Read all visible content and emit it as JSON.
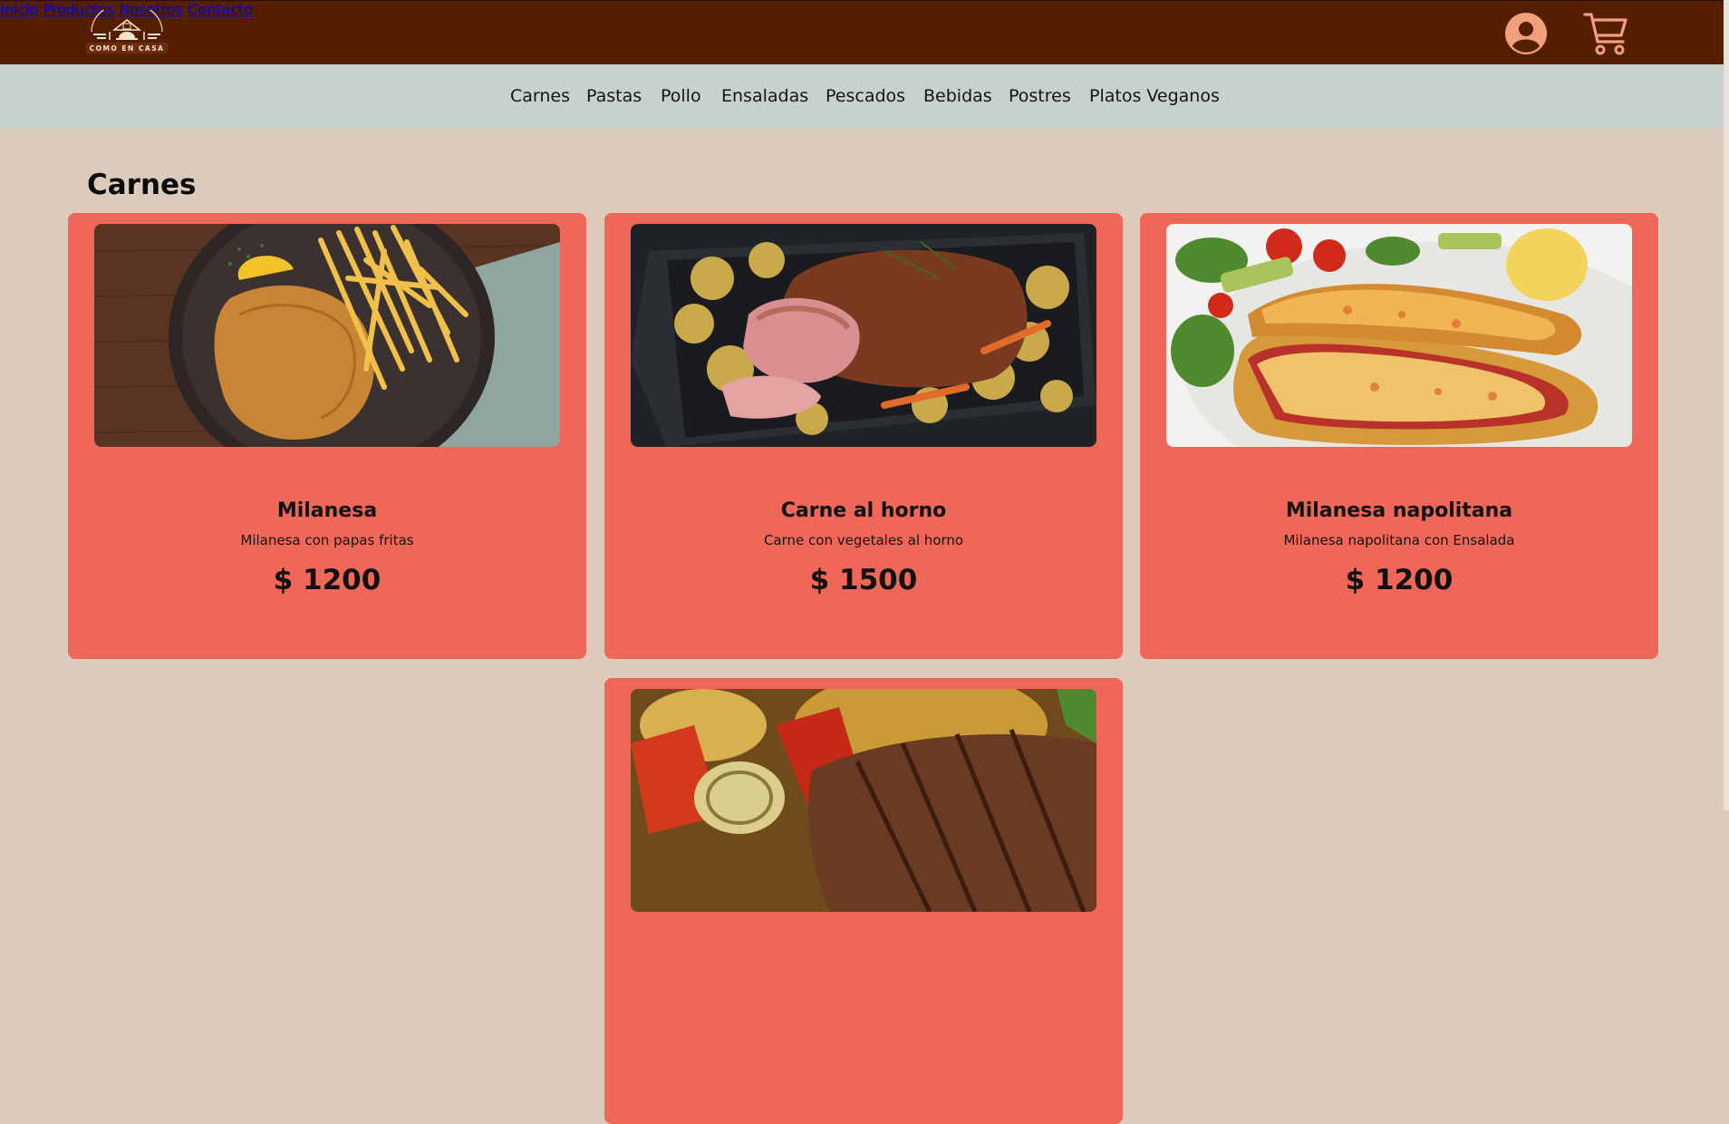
{
  "header": {
    "logo_text": "COMO EN CASA",
    "nav": [
      "Inicio",
      "Productos",
      "Nosotros",
      "Contacto"
    ],
    "icons": {
      "user": "user-account-icon",
      "cart": "shopping-cart-icon"
    }
  },
  "categories": [
    "Carnes",
    "Pastas",
    "Pollo",
    "Ensaladas",
    "Pescados",
    "Bebidas",
    "Postres",
    "Platos Veganos"
  ],
  "section": {
    "title": "Carnes"
  },
  "products": [
    {
      "name": "Milanesa",
      "description": "Milanesa con papas fritas",
      "price": "$ 1200",
      "image": "milanesa-photo"
    },
    {
      "name": "Carne al horno",
      "description": "Carne con vegetales al horno",
      "price": "$ 1500",
      "image": "roast-beef-photo"
    },
    {
      "name": "Milanesa napolitana",
      "description": "Milanesa napolitana con Ensalada",
      "price": "$ 1200",
      "image": "milanesa-napolitana-photo"
    },
    {
      "name": "",
      "description": "",
      "price": "",
      "image": "grilled-steak-photo"
    }
  ],
  "colors": {
    "header_bg": "#561e00",
    "nav_link": "#f0a07a",
    "category_bar": "#c7d1cd",
    "page_bg": "#dccbbb",
    "card_bg": "#ee6758"
  }
}
